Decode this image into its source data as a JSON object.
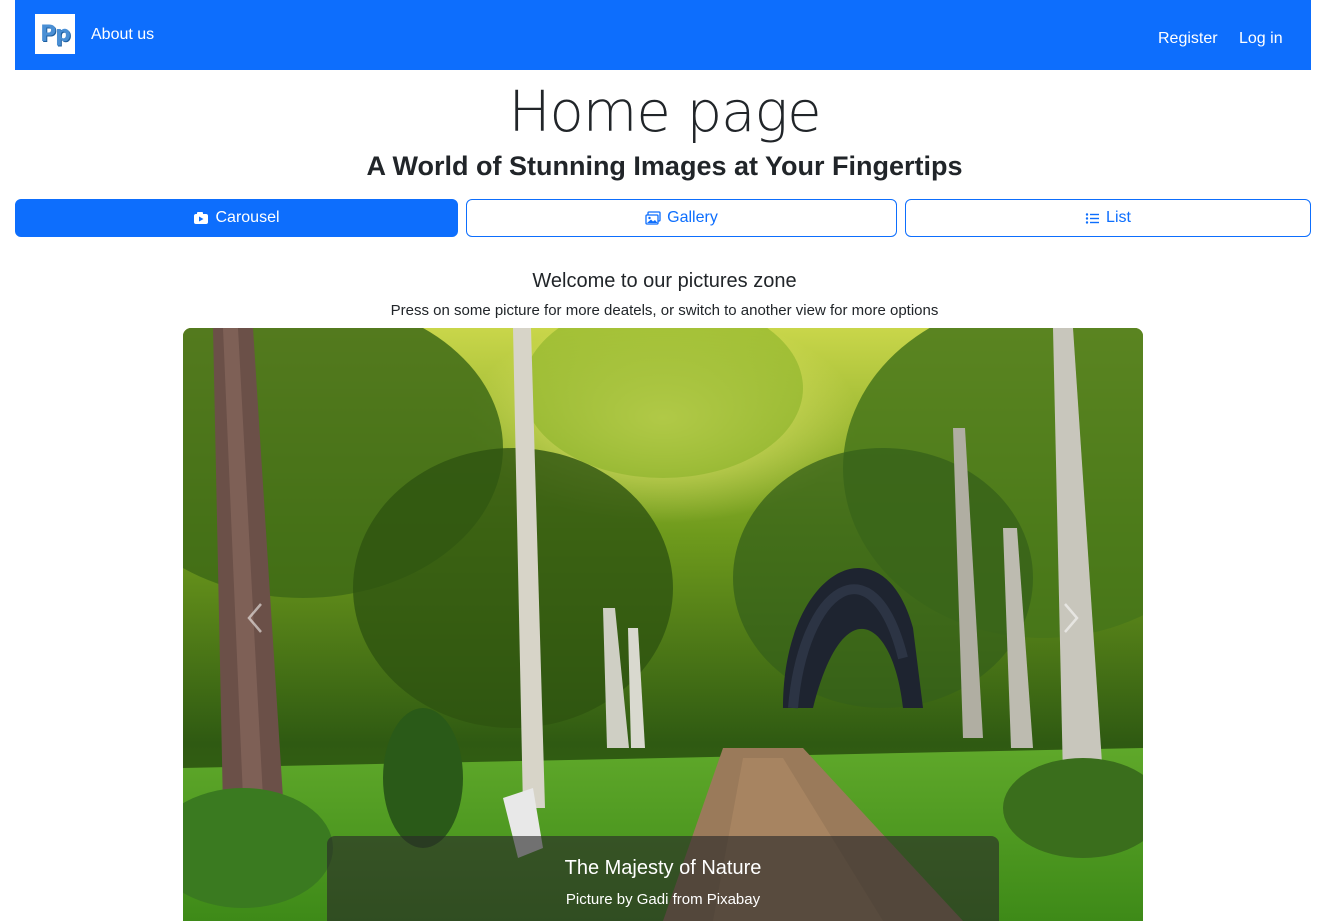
{
  "navbar": {
    "logo_text": "Pp",
    "about_label": "About us",
    "register_label": "Register",
    "login_label": "Log in",
    "background_color": "#0d6efd"
  },
  "header": {
    "title": "Home page",
    "subtitle": "A World of Stunning Images at Your Fingertips"
  },
  "view_switcher": {
    "active": "carousel",
    "buttons": [
      {
        "id": "carousel",
        "label": "Carousel",
        "icon": "camera-video-icon"
      },
      {
        "id": "gallery",
        "label": "Gallery",
        "icon": "images-icon"
      },
      {
        "id": "list",
        "label": "List",
        "icon": "list-ul-icon"
      }
    ]
  },
  "intro": {
    "welcome": "Welcome to our pictures zone",
    "instructions": "Press on some picture for more deatels, or switch to another view for more options"
  },
  "carousel": {
    "prev_icon": "chevron-left-icon",
    "next_icon": "chevron-right-icon",
    "slide": {
      "title": "The Majesty of Nature",
      "credit": "Picture by Gadi from Pixabay"
    }
  }
}
